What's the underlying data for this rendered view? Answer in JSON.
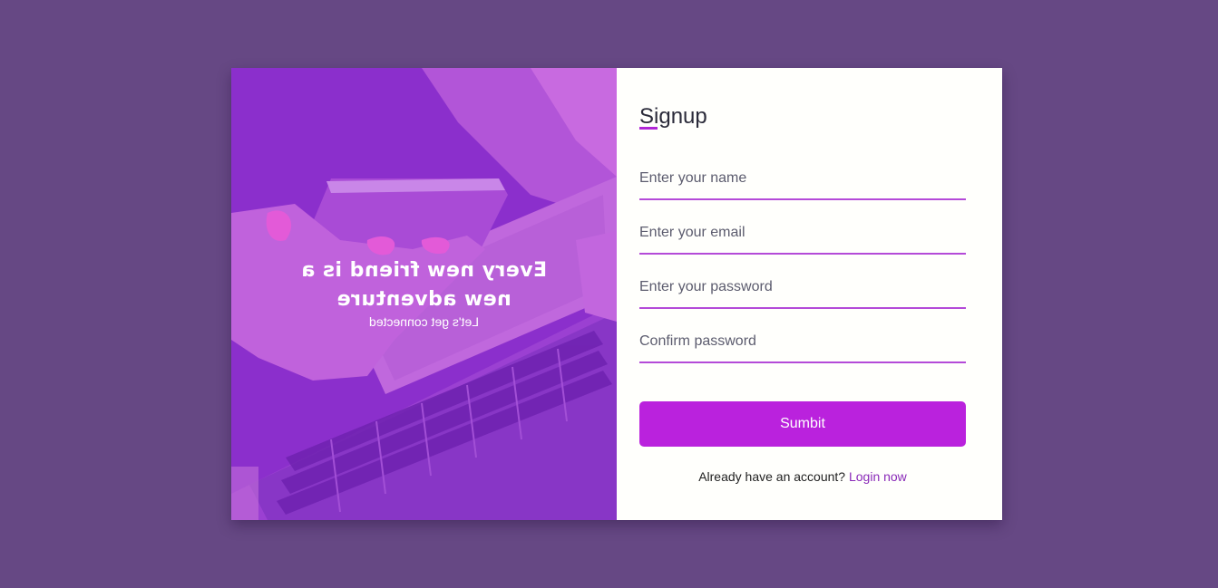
{
  "hero": {
    "title": "Every new friend is a new adventure",
    "subtitle": "Let's get connected",
    "image": "woman-holding-phone-over-laptop-photo"
  },
  "form": {
    "title": "Signup",
    "fields": {
      "name_placeholder": "Enter your name",
      "email_placeholder": "Enter your email",
      "password_placeholder": "Enter your password",
      "confirm_placeholder": "Confirm password"
    },
    "submit_label": "Sumbit",
    "login_prompt": "Already have an account?",
    "login_link": "Login now"
  },
  "colors": {
    "background": "#664884",
    "accent": "#ba22dd",
    "panel": "#fffffc"
  }
}
